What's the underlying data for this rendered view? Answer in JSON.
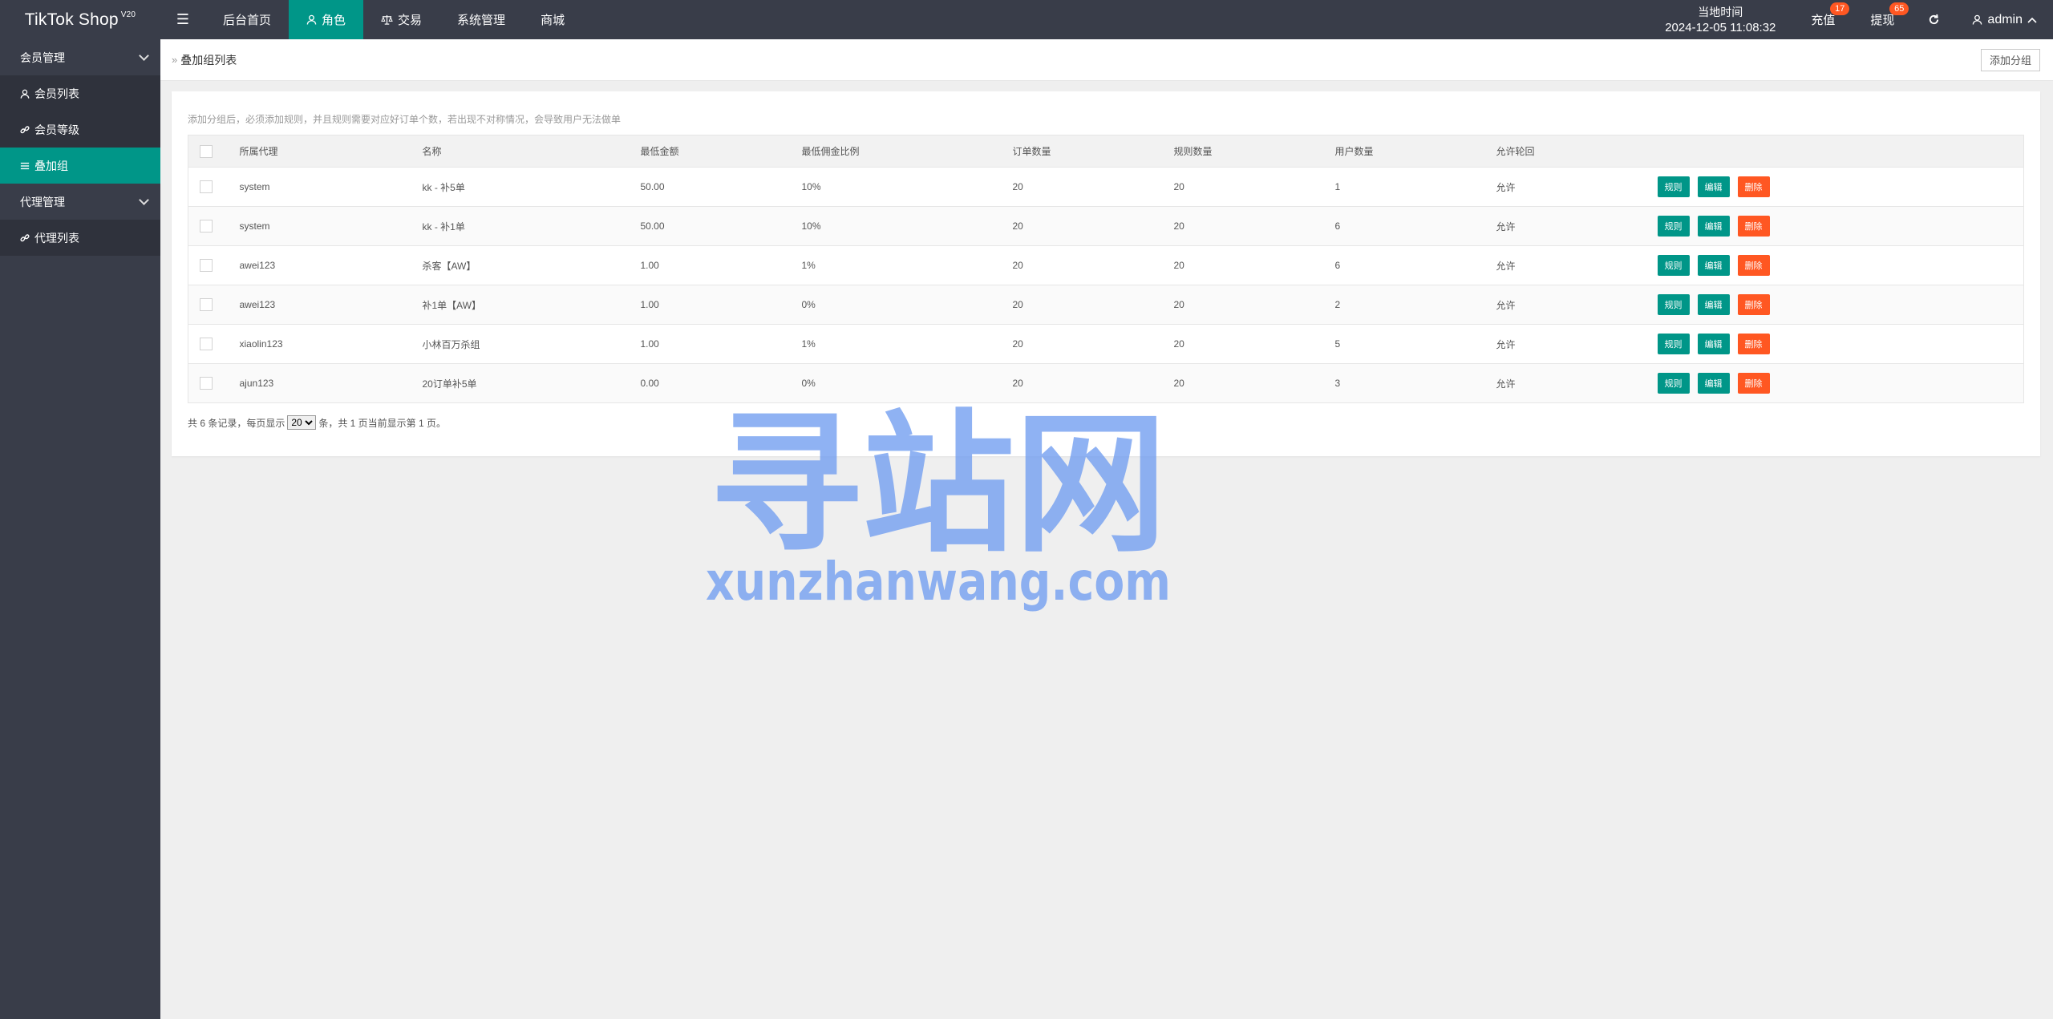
{
  "header": {
    "logo": "TikTok Shop",
    "logo_sup": "V20",
    "menu_icon": "hamburger-icon",
    "nav": [
      {
        "label": "后台首页",
        "icon": ""
      },
      {
        "label": "角色",
        "icon": "user-icon",
        "active": true
      },
      {
        "label": "交易",
        "icon": "scale-icon"
      },
      {
        "label": "系统管理",
        "icon": ""
      },
      {
        "label": "商城",
        "icon": ""
      }
    ],
    "clock_label": "当地时间",
    "clock_time": "2024-12-05 11:08:32",
    "recharge_label": "充值",
    "recharge_badge": "17",
    "withdraw_label": "提现",
    "withdraw_badge": "65",
    "refresh_icon": "refresh-icon",
    "user_label": "admin"
  },
  "sidebar": {
    "groups": [
      {
        "label": "会员管理",
        "items": [
          {
            "label": "会员列表",
            "icon": "user-icon"
          },
          {
            "label": "会员等级",
            "icon": "link-icon"
          },
          {
            "label": "叠加组",
            "icon": "list-icon",
            "active": true
          }
        ]
      },
      {
        "label": "代理管理",
        "items": [
          {
            "label": "代理列表",
            "icon": "link-icon"
          }
        ]
      }
    ]
  },
  "breadcrumb": {
    "title": "叠加组列表",
    "add_button": "添加分组"
  },
  "main": {
    "tip": "添加分组后，必须添加规则，并且规则需要对应好订单个数，若出现不对称情况，会导致用户无法做单",
    "columns": [
      "所属代理",
      "名称",
      "最低金额",
      "最低佣金比例",
      "订单数量",
      "规则数量",
      "用户数量",
      "允许轮回"
    ],
    "rows": [
      {
        "agent": "system",
        "name": "kk - 补5单",
        "min_amount": "50.00",
        "min_commission": "10%",
        "orders": "20",
        "rules": "20",
        "users": "1",
        "cycle": "允许"
      },
      {
        "agent": "system",
        "name": "kk - 补1单",
        "min_amount": "50.00",
        "min_commission": "10%",
        "orders": "20",
        "rules": "20",
        "users": "6",
        "cycle": "允许"
      },
      {
        "agent": "awei123",
        "name": "杀客【AW】",
        "min_amount": "1.00",
        "min_commission": "1%",
        "orders": "20",
        "rules": "20",
        "users": "6",
        "cycle": "允许"
      },
      {
        "agent": "awei123",
        "name": "补1单【AW】",
        "min_amount": "1.00",
        "min_commission": "0%",
        "orders": "20",
        "rules": "20",
        "users": "2",
        "cycle": "允许"
      },
      {
        "agent": "xiaolin123",
        "name": "小林百万杀组",
        "min_amount": "1.00",
        "min_commission": "1%",
        "orders": "20",
        "rules": "20",
        "users": "5",
        "cycle": "允许"
      },
      {
        "agent": "ajun123",
        "name": "20订单补5单",
        "min_amount": "0.00",
        "min_commission": "0%",
        "orders": "20",
        "rules": "20",
        "users": "3",
        "cycle": "允许"
      }
    ],
    "actions": {
      "rules": "规则",
      "edit": "编辑",
      "delete": "删除"
    },
    "pager": {
      "prefix": "共 6 条记录，每页显示",
      "page_size": "20",
      "suffix": "条，共 1 页当前显示第 1 页。"
    }
  },
  "watermark": {
    "cn": "寻站网",
    "en": "xunzhanwang.com"
  },
  "colors": {
    "header_bg": "#393d49",
    "accent": "#009688",
    "danger": "#ff5722",
    "watermark": "#6f9cf0"
  }
}
